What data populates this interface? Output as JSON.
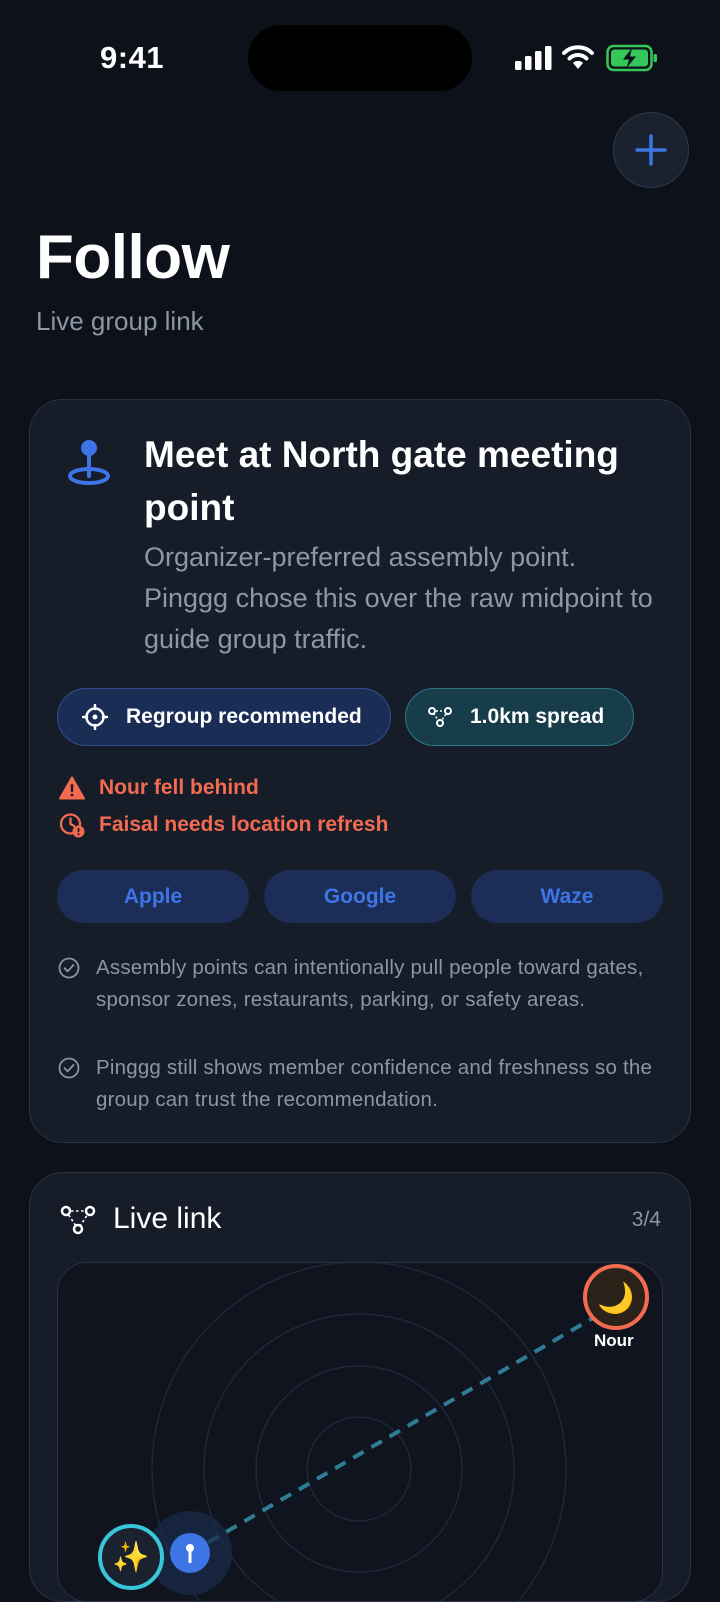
{
  "status_bar": {
    "time": "9:41"
  },
  "header": {
    "title": "Follow",
    "subtitle": "Live group link"
  },
  "meet_card": {
    "title": "Meet at North gate meeting point",
    "description": "Organizer-preferred assembly point. Pinggg chose this over the raw midpoint to guide group traffic.",
    "chips": {
      "regroup": "Regroup recommended",
      "spread": "1.0km spread"
    },
    "alerts": {
      "fell_behind": "Nour fell behind",
      "refresh": "Faisal needs location refresh"
    },
    "map_apps": {
      "apple": "Apple",
      "google": "Google",
      "waze": "Waze"
    },
    "notes": {
      "assembly": "Assembly points can intentionally pull people toward gates, sponsor zones, restaurants, parking, or safety areas.",
      "confidence": "Pinggg still shows member confidence and freshness so the group can trust the recommendation."
    }
  },
  "live_card": {
    "title": "Live link",
    "count": "3/4",
    "members": {
      "nour": {
        "name": "Nour",
        "emoji": "🌙"
      },
      "self": {
        "emoji": "✨"
      }
    }
  },
  "colors": {
    "background": "#0d1119",
    "card": "#161c28",
    "accent_blue": "#3d74e6",
    "alert": "#f26b50",
    "teal": "#2f7686"
  }
}
